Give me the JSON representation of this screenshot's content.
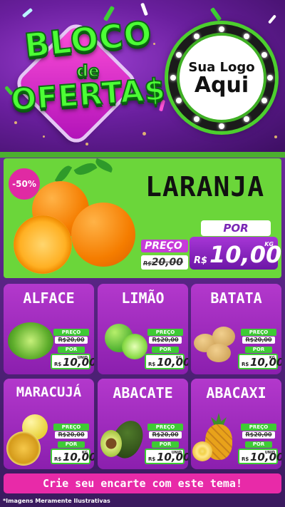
{
  "header": {
    "title_line1": "BLOCO",
    "title_line2": "de",
    "title_line3": "OFERTA$",
    "logo_line1": "Sua Logo",
    "logo_line2": "Aqui"
  },
  "hero": {
    "product": "LARANJA",
    "discount": "-50%",
    "preco_label": "PREÇO",
    "old_currency": "R$",
    "old_price": "20,00",
    "por_label": "POR",
    "new_currency": "R$",
    "new_price": "10,00",
    "unit": "KG"
  },
  "cards": [
    {
      "name": "ALFACE",
      "preco_label": "PREÇO",
      "old_currency": "R$",
      "old_price": "20,00",
      "por_label": "POR",
      "new_currency": "R$",
      "new_price": "10,00",
      "unit": "UNID"
    },
    {
      "name": "LIMÃO",
      "preco_label": "PREÇO",
      "old_currency": "R$",
      "old_price": "20,00",
      "por_label": "POR",
      "new_currency": "R$",
      "new_price": "10,00",
      "unit": "KG"
    },
    {
      "name": "BATATA",
      "preco_label": "PREÇO",
      "old_currency": "R$",
      "old_price": "20,00",
      "por_label": "POR",
      "new_currency": "R$",
      "new_price": "10,00",
      "unit": "KG"
    },
    {
      "name": "MARACUJÁ",
      "preco_label": "PREÇO",
      "old_currency": "R$",
      "old_price": "20,00",
      "por_label": "POR",
      "new_currency": "R$",
      "new_price": "10,00",
      "unit": "KG"
    },
    {
      "name": "ABACATE",
      "preco_label": "PREÇO",
      "old_currency": "R$",
      "old_price": "20,00",
      "por_label": "POR",
      "new_currency": "R$",
      "new_price": "10,00",
      "unit": "UNID"
    },
    {
      "name": "ABACAXI",
      "preco_label": "PREÇO",
      "old_currency": "R$",
      "old_price": "20,00",
      "por_label": "POR",
      "new_currency": "R$",
      "new_price": "10,00",
      "unit": "UNID"
    }
  ],
  "cta": "Crie seu encarte com este tema!",
  "footnote": "*Imagens Meramente Ilustrativas",
  "colors": {
    "purple": "#8b1fae",
    "green": "#6bd63a",
    "pink": "#e82aa8",
    "title_green": "#4cff35"
  }
}
